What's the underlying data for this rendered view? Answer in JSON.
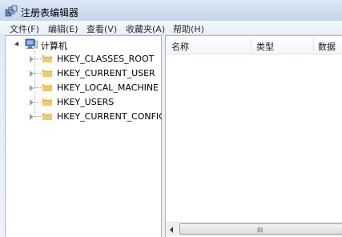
{
  "window": {
    "title": "注册表编辑器"
  },
  "menu": [
    {
      "label": "文件(F)"
    },
    {
      "label": "编辑(E)"
    },
    {
      "label": "查看(V)"
    },
    {
      "label": "收藏夹(A)"
    },
    {
      "label": "帮助(H)"
    }
  ],
  "tree": {
    "root": {
      "label": "计算机",
      "expanded": true
    },
    "items": [
      {
        "label": "HKEY_CLASSES_ROOT"
      },
      {
        "label": "HKEY_CURRENT_USER"
      },
      {
        "label": "HKEY_LOCAL_MACHINE"
      },
      {
        "label": "HKEY_USERS"
      },
      {
        "label": "HKEY_CURRENT_CONFIG"
      }
    ]
  },
  "list": {
    "columns": [
      {
        "label": "名称"
      },
      {
        "label": "类型"
      },
      {
        "label": "数据"
      }
    ],
    "scroll_grip": "III"
  },
  "colors": {
    "folder": "#e8c25a",
    "folder_dark": "#c99a2e",
    "border": "#a9b8c9"
  }
}
